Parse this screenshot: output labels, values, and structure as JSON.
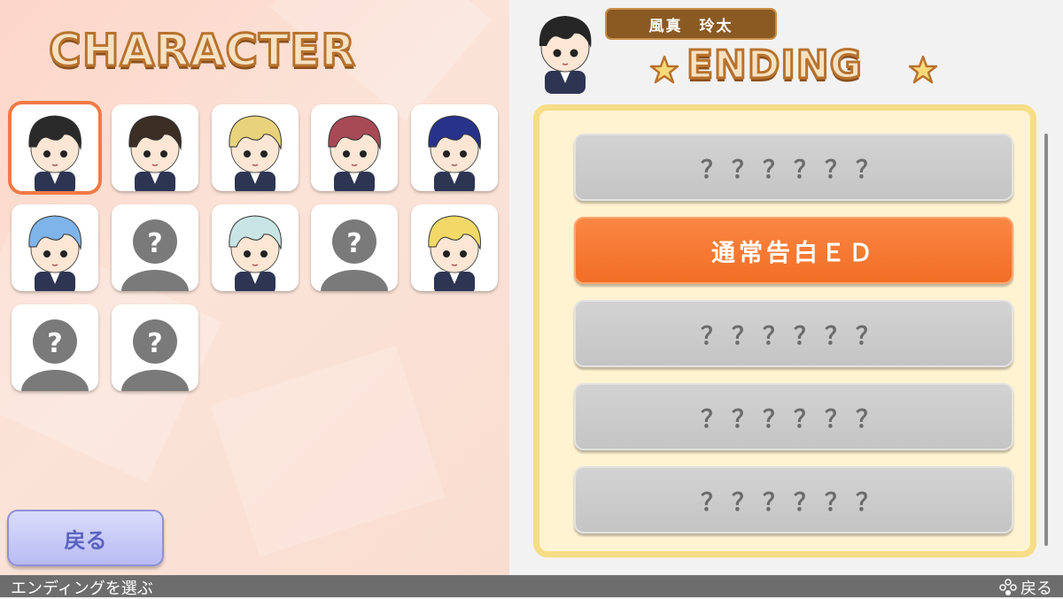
{
  "left_panel": {
    "title": "CHARACTER",
    "characters": [
      {
        "status": "unlocked",
        "hair": "#2a2a2a",
        "selected": true
      },
      {
        "status": "unlocked",
        "hair": "#3a2e25",
        "selected": false
      },
      {
        "status": "unlocked",
        "hair": "#e9d27c",
        "selected": false
      },
      {
        "status": "unlocked",
        "hair": "#a84a55",
        "selected": false
      },
      {
        "status": "unlocked",
        "hair": "#27338a",
        "selected": false
      },
      {
        "status": "unlocked",
        "hair": "#7fb4ea",
        "selected": false
      },
      {
        "status": "locked",
        "label": "?"
      },
      {
        "status": "unlocked",
        "hair": "#c9e4e4",
        "selected": false
      },
      {
        "status": "locked",
        "label": "?"
      },
      {
        "status": "unlocked",
        "hair": "#f1d867",
        "selected": false
      },
      {
        "status": "locked",
        "label": "?"
      },
      {
        "status": "locked",
        "label": "?"
      }
    ],
    "back_label": "戻る"
  },
  "right_panel": {
    "character_name": "風真　玲太",
    "title": "ENDING",
    "endings": [
      {
        "label": "？？？？？？",
        "state": "locked"
      },
      {
        "label": "通常告白ＥＤ",
        "state": "selected"
      },
      {
        "label": "？？？？？？",
        "state": "locked"
      },
      {
        "label": "？？？？？？",
        "state": "locked"
      },
      {
        "label": "？？？？？？",
        "state": "locked"
      }
    ]
  },
  "footer": {
    "hint": "エンディングを選ぶ",
    "back_label": "戻る"
  },
  "colors": {
    "accent_orange": "#f26d24",
    "selected_outline": "#f07a45",
    "panel_border": "#f6dd86",
    "back_button": "#b8bbf2"
  }
}
